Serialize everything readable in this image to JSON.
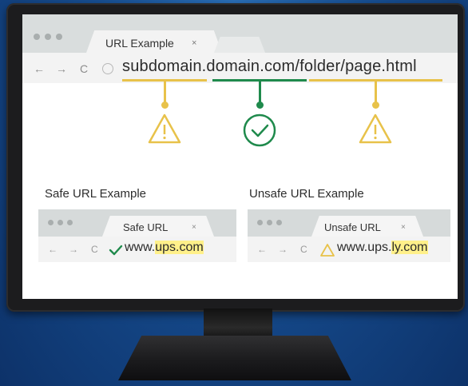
{
  "browser": {
    "tab_title": "URL Example",
    "tab_close": "×",
    "nav_back": "←",
    "nav_forward": "→",
    "nav_reload": "C",
    "url_parts": {
      "subdomain": "subdomain",
      "dot1": ".",
      "domain": "domain.com",
      "path": "/folder/page.html"
    }
  },
  "safe_example": {
    "label": "Safe URL Example",
    "tab_title": "Safe URL",
    "tab_close": "×",
    "nav_back": "←",
    "nav_forward": "→",
    "nav_reload": "C",
    "url_prefix": "www.",
    "url_domain": "ups.com"
  },
  "unsafe_example": {
    "label": "Unsafe URL Example",
    "tab_title": "Unsafe URL",
    "tab_close": "×",
    "nav_back": "←",
    "nav_forward": "→",
    "nav_reload": "C",
    "url_prefix": "www.ups.",
    "url_suffix": "ly.com"
  },
  "colors": {
    "warning": "#e8c24a",
    "safe": "#1f8a4c",
    "highlight": "#fff08a"
  },
  "icons": {
    "subdomain_marker": "warning-triangle-icon",
    "domain_marker": "check-circle-icon",
    "path_marker": "warning-triangle-icon"
  }
}
